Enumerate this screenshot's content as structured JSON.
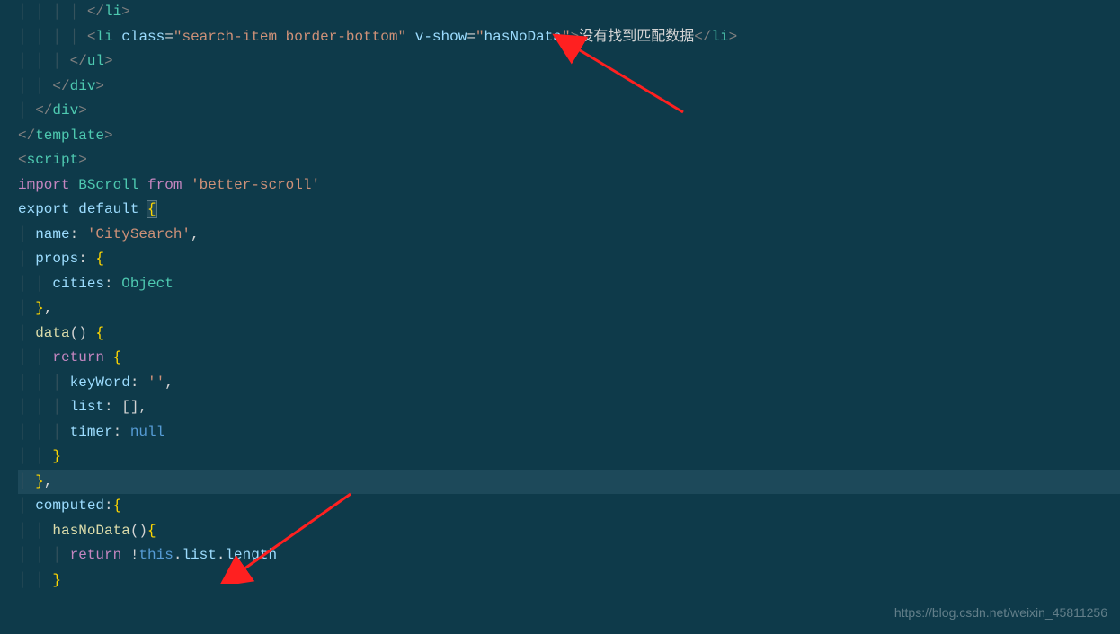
{
  "code": {
    "lines": [
      {
        "indent": "│ │ │ │ ",
        "segments": [
          {
            "t": "bracket",
            "v": "</"
          },
          {
            "t": "tag",
            "v": "li"
          },
          {
            "t": "bracket",
            "v": ">"
          }
        ]
      },
      {
        "indent": "│ │ │ │ ",
        "segments": [
          {
            "t": "bracket",
            "v": "<"
          },
          {
            "t": "tag",
            "v": "li"
          },
          {
            "t": "punct",
            "v": " "
          },
          {
            "t": "attr-name",
            "v": "class"
          },
          {
            "t": "operator",
            "v": "="
          },
          {
            "t": "string",
            "v": "\"search-item border-bottom\""
          },
          {
            "t": "punct",
            "v": " "
          },
          {
            "t": "attr-name",
            "v": "v-show"
          },
          {
            "t": "operator",
            "v": "="
          },
          {
            "t": "string",
            "v": "\""
          },
          {
            "t": "property",
            "v": "hasNoData"
          },
          {
            "t": "string",
            "v": "\""
          },
          {
            "t": "bracket",
            "v": ">"
          },
          {
            "t": "text-cn",
            "v": "没有找到匹配数据"
          },
          {
            "t": "bracket",
            "v": "</"
          },
          {
            "t": "tag",
            "v": "li"
          },
          {
            "t": "bracket",
            "v": ">"
          }
        ]
      },
      {
        "indent": "│ │ │ ",
        "segments": [
          {
            "t": "bracket",
            "v": "</"
          },
          {
            "t": "tag",
            "v": "ul"
          },
          {
            "t": "bracket",
            "v": ">"
          }
        ]
      },
      {
        "indent": "│ │ ",
        "segments": [
          {
            "t": "bracket",
            "v": "</"
          },
          {
            "t": "tag",
            "v": "div"
          },
          {
            "t": "bracket",
            "v": ">"
          }
        ]
      },
      {
        "indent": "│ ",
        "segments": [
          {
            "t": "bracket",
            "v": "</"
          },
          {
            "t": "tag",
            "v": "div"
          },
          {
            "t": "bracket",
            "v": ">"
          }
        ]
      },
      {
        "indent": "",
        "segments": [
          {
            "t": "bracket",
            "v": "</"
          },
          {
            "t": "tag",
            "v": "template"
          },
          {
            "t": "bracket",
            "v": ">"
          }
        ]
      },
      {
        "indent": "",
        "segments": []
      },
      {
        "indent": "",
        "segments": [
          {
            "t": "bracket",
            "v": "<"
          },
          {
            "t": "tag",
            "v": "script"
          },
          {
            "t": "bracket",
            "v": ">"
          }
        ]
      },
      {
        "indent": "",
        "segments": [
          {
            "t": "keyword-import",
            "v": "import"
          },
          {
            "t": "punct",
            "v": " "
          },
          {
            "t": "class-name",
            "v": "BScroll"
          },
          {
            "t": "punct",
            "v": " "
          },
          {
            "t": "keyword-import",
            "v": "from"
          },
          {
            "t": "punct",
            "v": " "
          },
          {
            "t": "string",
            "v": "'better-scroll'"
          }
        ]
      },
      {
        "indent": "",
        "segments": [
          {
            "t": "keyword-export",
            "v": "export"
          },
          {
            "t": "punct",
            "v": " "
          },
          {
            "t": "keyword-default",
            "v": "default"
          },
          {
            "t": "punct",
            "v": " "
          },
          {
            "t": "brace box",
            "v": "{"
          }
        ]
      },
      {
        "indent": "│ ",
        "segments": [
          {
            "t": "property",
            "v": "name"
          },
          {
            "t": "punct",
            "v": ": "
          },
          {
            "t": "string",
            "v": "'CitySearch'"
          },
          {
            "t": "punct",
            "v": ","
          }
        ]
      },
      {
        "indent": "│ ",
        "segments": [
          {
            "t": "property",
            "v": "props"
          },
          {
            "t": "punct",
            "v": ": "
          },
          {
            "t": "brace",
            "v": "{"
          }
        ]
      },
      {
        "indent": "│ │ ",
        "segments": [
          {
            "t": "property",
            "v": "cities"
          },
          {
            "t": "punct",
            "v": ": "
          },
          {
            "t": "class-name",
            "v": "Object"
          }
        ]
      },
      {
        "indent": "│ ",
        "segments": [
          {
            "t": "brace",
            "v": "}"
          },
          {
            "t": "punct",
            "v": ","
          }
        ]
      },
      {
        "indent": "│ ",
        "segments": [
          {
            "t": "function-name",
            "v": "data"
          },
          {
            "t": "punct",
            "v": "() "
          },
          {
            "t": "brace",
            "v": "{"
          }
        ]
      },
      {
        "indent": "│ │ ",
        "segments": [
          {
            "t": "keyword-return",
            "v": "return"
          },
          {
            "t": "punct",
            "v": " "
          },
          {
            "t": "brace",
            "v": "{"
          }
        ]
      },
      {
        "indent": "│ │ │ ",
        "segments": [
          {
            "t": "property",
            "v": "keyWord"
          },
          {
            "t": "punct",
            "v": ": "
          },
          {
            "t": "string",
            "v": "''"
          },
          {
            "t": "punct",
            "v": ","
          }
        ]
      },
      {
        "indent": "│ │ │ ",
        "segments": [
          {
            "t": "property",
            "v": "list"
          },
          {
            "t": "punct",
            "v": ": []"
          },
          {
            "t": "punct",
            "v": ","
          }
        ]
      },
      {
        "indent": "│ │ │ ",
        "segments": [
          {
            "t": "property",
            "v": "timer"
          },
          {
            "t": "punct",
            "v": ": "
          },
          {
            "t": "keyword-null",
            "v": "null"
          }
        ]
      },
      {
        "indent": "│ │ ",
        "segments": [
          {
            "t": "brace",
            "v": "}"
          }
        ]
      },
      {
        "indent": "│ ",
        "highlighted": true,
        "segments": [
          {
            "t": "brace",
            "v": "}"
          },
          {
            "t": "punct",
            "v": ","
          }
        ]
      },
      {
        "indent": "│ ",
        "segments": [
          {
            "t": "property",
            "v": "computed"
          },
          {
            "t": "punct",
            "v": ":"
          },
          {
            "t": "brace",
            "v": "{"
          }
        ]
      },
      {
        "indent": "│ │ ",
        "segments": [
          {
            "t": "function-name",
            "v": "hasNoData"
          },
          {
            "t": "punct",
            "v": "()"
          },
          {
            "t": "brace",
            "v": "{"
          }
        ]
      },
      {
        "indent": "│ │ │ ",
        "segments": [
          {
            "t": "keyword-return",
            "v": "return"
          },
          {
            "t": "punct",
            "v": " !"
          },
          {
            "t": "keyword-this",
            "v": "this"
          },
          {
            "t": "punct",
            "v": "."
          },
          {
            "t": "property",
            "v": "list"
          },
          {
            "t": "punct",
            "v": "."
          },
          {
            "t": "property",
            "v": "length"
          }
        ]
      },
      {
        "indent": "│ │ ",
        "segments": [
          {
            "t": "brace",
            "v": "}"
          }
        ]
      }
    ]
  },
  "watermark": "https://blog.csdn.net/weixin_45811256"
}
